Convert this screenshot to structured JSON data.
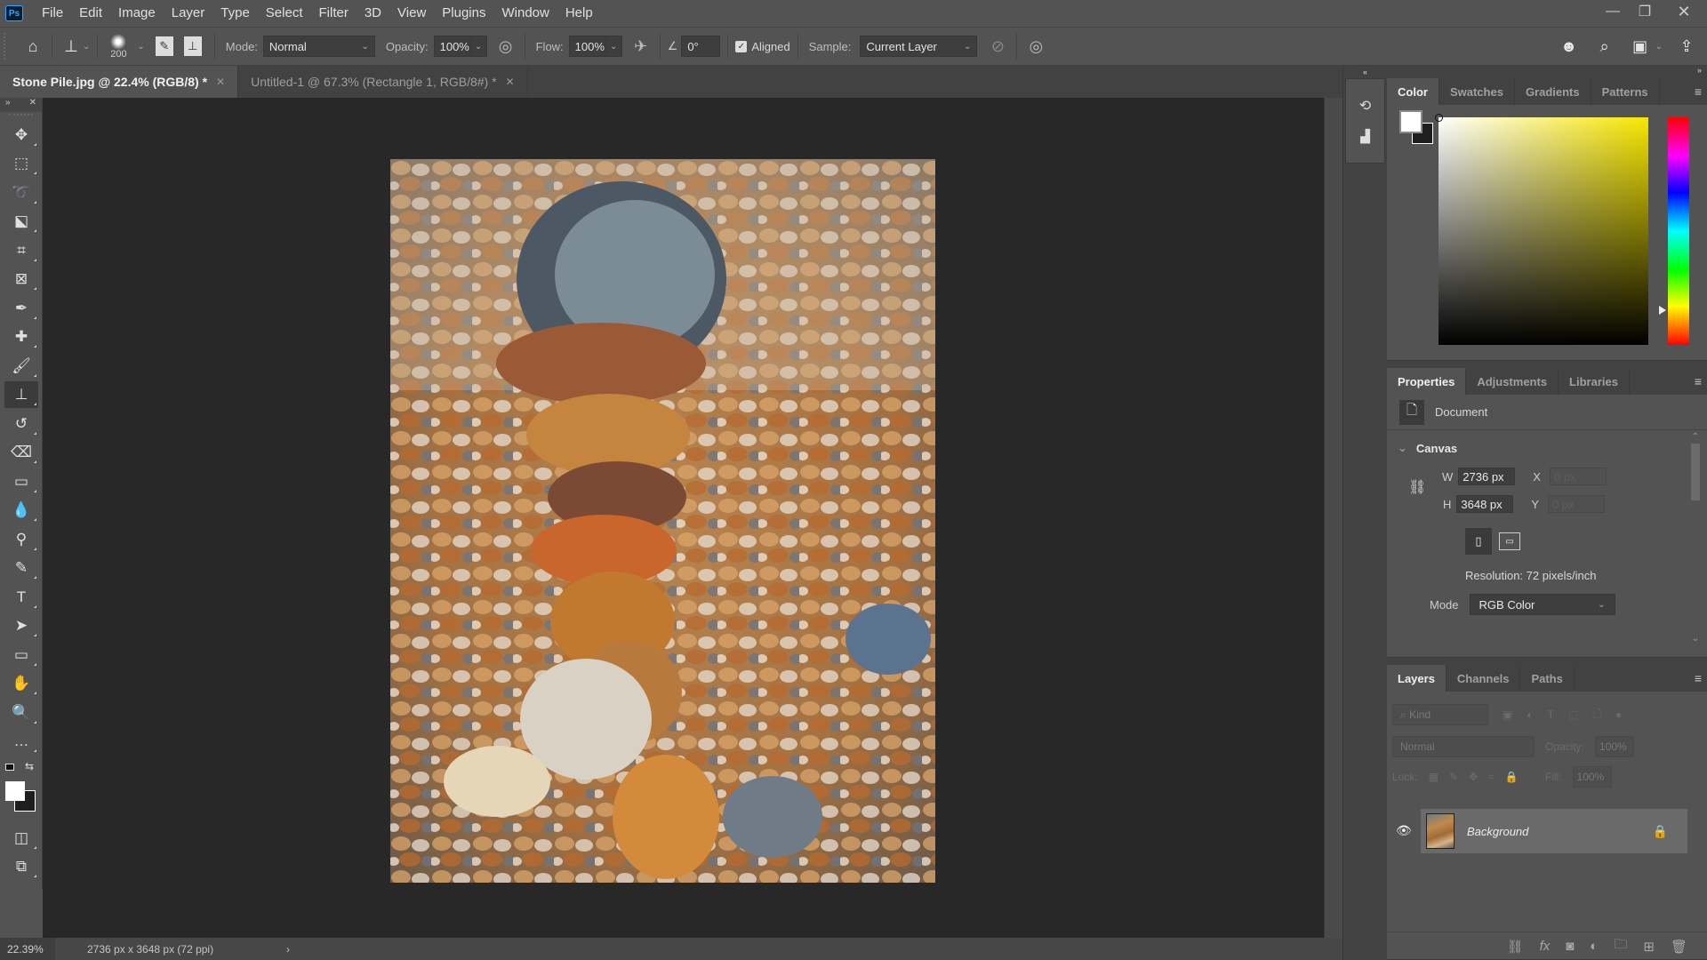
{
  "app": {
    "logo": "Ps"
  },
  "menu": [
    "File",
    "Edit",
    "Image",
    "Layer",
    "Type",
    "Select",
    "Filter",
    "3D",
    "View",
    "Plugins",
    "Window",
    "Help"
  ],
  "window_controls": {
    "minimize": "—",
    "restore": "❐",
    "close": "✕"
  },
  "options_bar": {
    "brush_size": "200",
    "mode_label": "Mode:",
    "mode_value": "Normal",
    "opacity_label": "Opacity:",
    "opacity_value": "100%",
    "flow_label": "Flow:",
    "flow_value": "100%",
    "angle_value": "0°",
    "aligned_label": "Aligned",
    "aligned_checked": true,
    "sample_label": "Sample:",
    "sample_value": "Current Layer"
  },
  "tabs": [
    {
      "label": "Stone Pile.jpg @ 22.4% (RGB/8) *",
      "active": true
    },
    {
      "label": "Untitled-1 @ 67.3% (Rectangle 1, RGB/8#) *",
      "active": false
    }
  ],
  "tools": [
    {
      "name": "move-tool",
      "glyph": "✥"
    },
    {
      "name": "marquee-tool",
      "glyph": "⬚"
    },
    {
      "name": "lasso-tool",
      "glyph": "➰"
    },
    {
      "name": "object-selection-tool",
      "glyph": "⬕"
    },
    {
      "name": "crop-tool",
      "glyph": "⌗"
    },
    {
      "name": "frame-tool",
      "glyph": "⊠"
    },
    {
      "name": "eyedropper-tool",
      "glyph": "✒"
    },
    {
      "name": "healing-brush-tool",
      "glyph": "✚"
    },
    {
      "name": "brush-tool",
      "glyph": "🖌"
    },
    {
      "name": "clone-stamp-tool",
      "glyph": "⊥",
      "active": true
    },
    {
      "name": "history-brush-tool",
      "glyph": "↺"
    },
    {
      "name": "eraser-tool",
      "glyph": "⌫"
    },
    {
      "name": "gradient-tool",
      "glyph": "▭"
    },
    {
      "name": "blur-tool",
      "glyph": "💧"
    },
    {
      "name": "dodge-tool",
      "glyph": "⚲"
    },
    {
      "name": "pen-tool",
      "glyph": "✎"
    },
    {
      "name": "type-tool",
      "glyph": "T"
    },
    {
      "name": "path-selection-tool",
      "glyph": "➤"
    },
    {
      "name": "rectangle-tool",
      "glyph": "▭"
    },
    {
      "name": "hand-tool",
      "glyph": "✋"
    },
    {
      "name": "zoom-tool",
      "glyph": "🔍"
    },
    {
      "name": "more-tools",
      "glyph": "…"
    }
  ],
  "toolbar_header": {
    "collapse": "»",
    "close": "✕"
  },
  "status": {
    "zoom": "22.39%",
    "doc_info": "2736 px x 3648 px (72 ppi)",
    "arrow": "›"
  },
  "color_panel": {
    "tabs": [
      "Color",
      "Swatches",
      "Gradients",
      "Patterns"
    ],
    "active_tab": "Color",
    "foreground": "#ffffff",
    "background": "#1e1e1e",
    "hue_color": "#f7e600"
  },
  "properties_panel": {
    "tabs": [
      "Properties",
      "Adjustments",
      "Libraries"
    ],
    "active_tab": "Properties",
    "doc_label": "Document",
    "section": "Canvas",
    "w_label": "W",
    "w_value": "2736 px",
    "h_label": "H",
    "h_value": "3648 px",
    "x_label": "X",
    "x_value": "0 px",
    "y_label": "Y",
    "y_value": "0 px",
    "resolution": "Resolution: 72 pixels/inch",
    "mode_label": "Mode",
    "mode_value": "RGB Color"
  },
  "layers_panel": {
    "tabs": [
      "Layers",
      "Channels",
      "Paths"
    ],
    "active_tab": "Layers",
    "filter_placeholder": "Kind",
    "blend_mode": "Normal",
    "opacity_label": "Opacity:",
    "opacity_value": "100%",
    "lock_label": "Lock:",
    "fill_label": "Fill:",
    "fill_value": "100%",
    "layers": [
      {
        "name": "Background",
        "visible": true,
        "locked": true
      }
    ]
  }
}
